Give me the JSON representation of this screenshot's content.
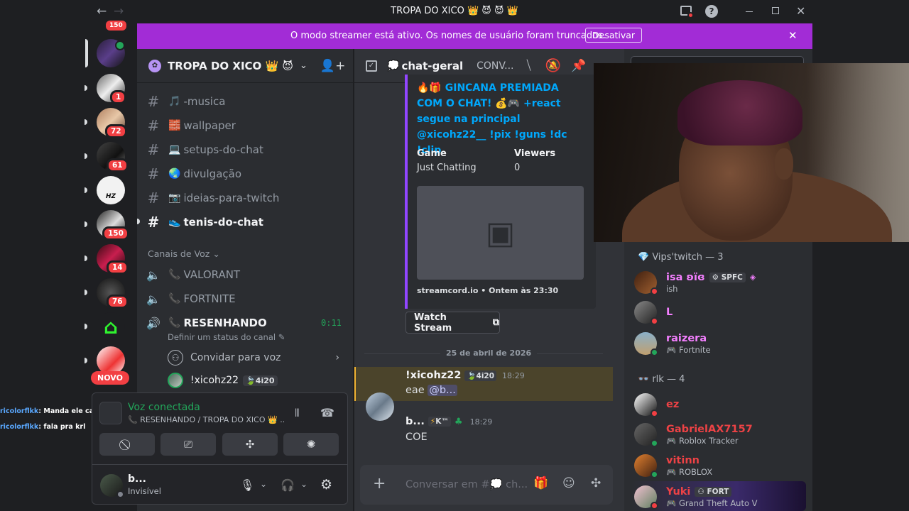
{
  "window": {
    "title": "TROPA DO XICO 👑 😈 😈 👑"
  },
  "banner": {
    "text": "O modo streamer está ativo. Os nomes de usuário foram truncados.",
    "button": "Desativar"
  },
  "servers": [
    {
      "badge": "1"
    },
    {
      "badge": "72"
    },
    {
      "badge": "61"
    },
    {
      "badge": "HZ"
    },
    {
      "badge": "150"
    },
    {
      "badge": "14"
    },
    {
      "badge": "76"
    },
    {
      "badge": "NOVO"
    }
  ],
  "guild": {
    "name": "TROPA DO XICO 👑 😈 ..."
  },
  "channels": [
    {
      "name": "-musica",
      "emoji": "🎵"
    },
    {
      "name": "wallpaper",
      "emoji": "🧱"
    },
    {
      "name": "setups-do-chat",
      "emoji": "💻"
    },
    {
      "name": "divulgação",
      "emoji": "🌏"
    },
    {
      "name": "ideias-para-twitch",
      "emoji": "📷"
    },
    {
      "name": "tenis-do-chat",
      "emoji": "👟"
    }
  ],
  "voice": {
    "category": "Canais de Voz",
    "channels": [
      {
        "name": "VALORANT",
        "emoji": "📞"
      },
      {
        "name": "FORTNITE",
        "emoji": "📞"
      },
      {
        "name": "RESENHANDO",
        "emoji": "📞",
        "timer": "0:11"
      }
    ],
    "status_hint": "Definir um status do canal",
    "invite": "Convidar para voz",
    "participant": {
      "name": "!xicohz22",
      "tag": "4i20"
    }
  },
  "overlay_chat": [
    {
      "user": "ricolorflkk",
      "msg": "Manda ele calar a boca"
    },
    {
      "user": "ricolorflkk",
      "msg": "fala pra krl"
    }
  ],
  "voice_panel": {
    "status": "Voz conectada",
    "location": "📞 RESENHANDO / TROPA DO XICO 👑 ..."
  },
  "user_panel": {
    "name": "b...",
    "status": "Invisível"
  },
  "chat": {
    "channel": "chat-geral",
    "tab2": "CONV...",
    "embed": {
      "title": "🔥🎁 GINCANA PREMIADA COM O CHAT! 💰🎮 +react segue na principal @xicohz22__ !pix !guns !dc !clip",
      "field1_name": "Game",
      "field1_value": "Just Chatting",
      "field2_name": "Viewers",
      "field2_value": "0",
      "footer": "streamcord.io • Ontem às 23:30"
    },
    "watch_button": "Watch Stream",
    "date_divider": "25 de abril de 2026",
    "messages": [
      {
        "author": "!xicohz22",
        "tag": "4i20",
        "time": "18:29",
        "text": "eae",
        "mention": "@b..."
      },
      {
        "author": "b...",
        "tag": "K™",
        "time": "18:29",
        "text": "COE"
      }
    ],
    "input_placeholder": "Conversar em #💭 ch..."
  },
  "members": {
    "group1": "Vips'twitch — 3",
    "group1_members": [
      {
        "name": "isa ʚїɞ",
        "tag": "SPFC",
        "sub": "ish",
        "color": "#f47fff"
      },
      {
        "name": "L",
        "sub": "",
        "color": "#f47fff"
      },
      {
        "name": "raizera",
        "sub": "Fortnite",
        "color": "#f47fff"
      }
    ],
    "group2": "rlk — 4",
    "group2_members": [
      {
        "name": "ez",
        "sub": "",
        "color": "#ed4245"
      },
      {
        "name": "GabrielAX7157",
        "sub": "Roblox Tracker",
        "color": "#ed4245"
      },
      {
        "name": "vitinn",
        "sub": "ROBLOX",
        "color": "#ed4245"
      },
      {
        "name": "Yuki",
        "tag": "FORT",
        "sub": "Grand Theft Auto V",
        "color": "#ed4245"
      }
    ]
  },
  "colors": {
    "accent": "#a22cd6",
    "online": "#23a55a",
    "dnd": "#f23f43",
    "blurple": "#5865f2"
  }
}
